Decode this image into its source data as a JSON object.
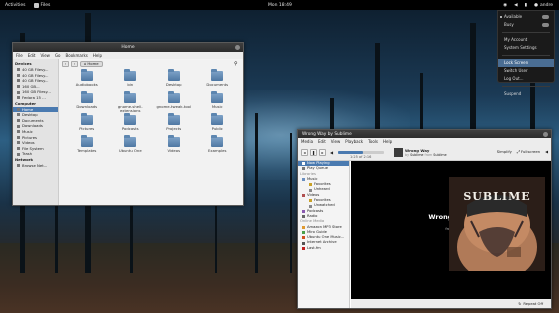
{
  "topbar": {
    "activities": "Activities",
    "app_name": "Files",
    "clock": "Mon 18:49",
    "user": "andre"
  },
  "user_menu": {
    "items": [
      {
        "label": "Available",
        "highlighted": false,
        "toggle": true
      },
      {
        "label": "Busy",
        "highlighted": false,
        "toggle": true
      },
      {
        "label": "My Account",
        "highlighted": false
      },
      {
        "label": "System Settings",
        "highlighted": false
      },
      {
        "label": "Lock Screen",
        "highlighted": true
      },
      {
        "label": "Switch User",
        "highlighted": false
      },
      {
        "label": "Log Out...",
        "highlighted": false
      },
      {
        "label": "Suspend",
        "highlighted": false
      }
    ]
  },
  "files_window": {
    "title": "Home",
    "menu": [
      "File",
      "Edit",
      "View",
      "Go",
      "Bookmarks",
      "Help"
    ],
    "sidebar": {
      "devices_header": "Devices",
      "devices": [
        "40 GB Filesy...",
        "40 GB Filesy...",
        "40 GB Filesy...",
        "160 GB...",
        "160 GB Filesy...",
        "Fedora 15 ..."
      ],
      "computer_header": "Computer",
      "computer": [
        "Home",
        "Desktop",
        "Documents",
        "Downloads",
        "Music",
        "Pictures",
        "Videos",
        "File System",
        "Trash"
      ],
      "network_header": "Network",
      "network": [
        "Browse Net..."
      ]
    },
    "breadcrumb": "Home",
    "items": [
      "Audiobooks",
      "bin",
      "Desktop",
      "Documents",
      "Downloads",
      "gnome-shell-extensions",
      "gnome-tweak-tool",
      "Music",
      "Pictures",
      "Podcasts",
      "Projects",
      "Public",
      "Templates",
      "Ubuntu One",
      "Videos",
      "Examples"
    ]
  },
  "music_window": {
    "title": "Wrong Way by Sublime",
    "menu": [
      "Media",
      "Edit",
      "View",
      "Playback",
      "Tools",
      "Help"
    ],
    "seek_fraction": 0.55,
    "seek_time": "1:25 of 2:16",
    "now_playing": {
      "title": "Wrong Way",
      "by": "by",
      "artist": "Sublime",
      "from": "from",
      "album": "Sublime"
    },
    "toolbar_right": [
      "Simplify",
      "Fullscreen"
    ],
    "sidebar": {
      "items_top": [
        "Now Playing",
        "Play Queue"
      ],
      "libraries_header": "Libraries",
      "music_label": "Music",
      "music_sub": [
        "Favorites",
        "Unheard"
      ],
      "videos_label": "Videos",
      "videos_sub": [
        "Favorites",
        "Unwatched"
      ],
      "other_libs": [
        "Podcasts",
        "Radio"
      ],
      "online_header": "Online Media",
      "online": [
        "Amazon MP3 Store",
        "Miro Guide",
        "Ubuntu One Music...",
        "Internet Archive",
        "Last.fm"
      ]
    },
    "track_title": "Wrong Way",
    "track_by": "by Sublime",
    "track_from": "from Sublime",
    "album_text": "SUBLIME",
    "status": "Repeat Off",
    "colors": {
      "accent": "#4a7ab0"
    }
  }
}
